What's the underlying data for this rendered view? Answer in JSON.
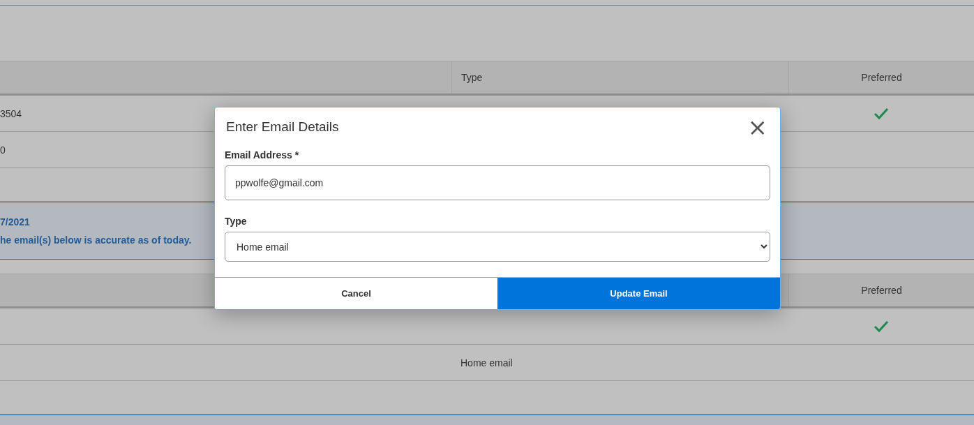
{
  "tables": [
    {
      "columns": [
        "",
        "Type",
        "Preferred"
      ],
      "rows": [
        {
          "value": "3504",
          "type": "",
          "preferred": true
        },
        {
          "value": "0",
          "type": "",
          "preferred": false
        },
        {
          "value": "",
          "type": "",
          "preferred": false
        }
      ]
    },
    {
      "notice": {
        "date": "7/2021",
        "text": "he email(s) below is accurate as of today."
      },
      "columns": [
        "",
        "",
        "Preferred"
      ],
      "rows": [
        {
          "value": "",
          "type": "",
          "preferred": true
        },
        {
          "value": "",
          "type": "Home email",
          "preferred": false
        },
        {
          "value": "",
          "type": "",
          "preferred": false
        }
      ]
    }
  ],
  "dialog": {
    "title": "Enter Email Details",
    "close": "×",
    "fields": [
      {
        "kind": "text",
        "label": "Email Address *",
        "value": "ppwolfe@gmail.com"
      },
      {
        "kind": "select",
        "label": "Type",
        "value": "Home email"
      }
    ],
    "buttons": [
      {
        "label": "Cancel",
        "kind": "secondary"
      },
      {
        "label": "Update Email",
        "kind": "primary"
      }
    ]
  }
}
